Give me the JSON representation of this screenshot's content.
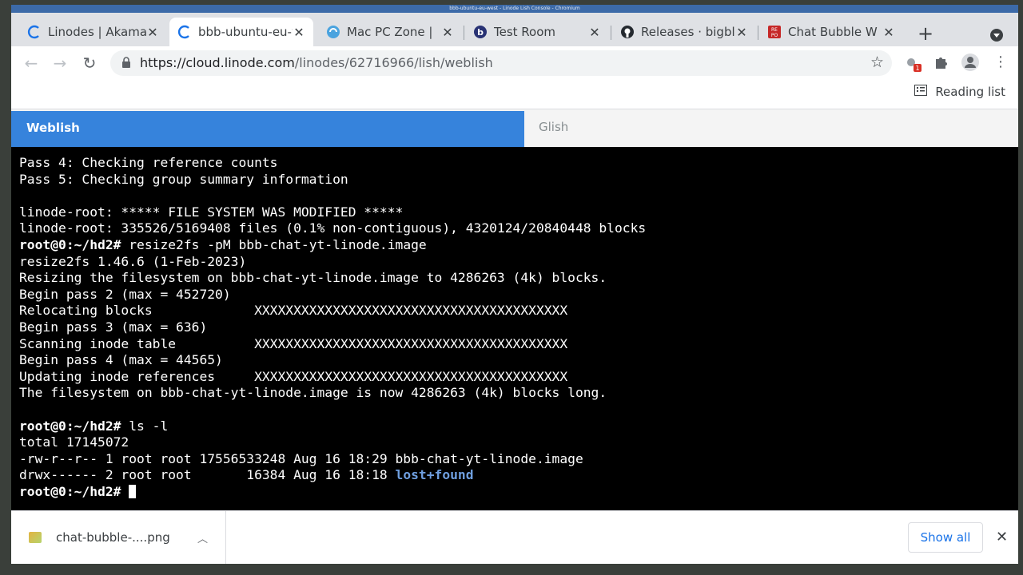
{
  "window": {
    "title": "bbb-ubuntu-eu-west - Linode Lish Console - Chromium"
  },
  "tabs": [
    {
      "title": "Linodes | Akamai",
      "icon": "linode-icon"
    },
    {
      "title": "bbb-ubuntu-eu-west",
      "icon": "linode-icon",
      "active": true
    },
    {
      "title": "Mac PC Zone | ",
      "icon": "macpczone-icon"
    },
    {
      "title": "Test Room",
      "icon": "bigbluebutton-icon"
    },
    {
      "title": "Releases · bigbluebutton",
      "icon": "github-icon"
    },
    {
      "title": "Chat Bubble W",
      "icon": "repo-icon"
    }
  ],
  "toolbar": {
    "url_host": "https://cloud.linode.com",
    "url_path": "/linodes/62716966/lish/weblish",
    "extension_badge": "1",
    "reading_list": "Reading list"
  },
  "lish": {
    "tab_weblish": "Weblish",
    "tab_glish": "Glish"
  },
  "terminal": {
    "lines": [
      {
        "text": "Pass 4: Checking reference counts"
      },
      {
        "text": "Pass 5: Checking group summary information"
      },
      {
        "text": ""
      },
      {
        "text": "linode-root: ***** FILE SYSTEM WAS MODIFIED *****"
      },
      {
        "text": "linode-root: 335526/5169408 files (0.1% non-contiguous), 4320124/20840448 blocks"
      },
      {
        "prompt": "root@0:~/hd2#",
        "text": " resize2fs -pM bbb-chat-yt-linode.image"
      },
      {
        "text": "resize2fs 1.46.6 (1-Feb-2023)"
      },
      {
        "text": "Resizing the filesystem on bbb-chat-yt-linode.image to 4286263 (4k) blocks."
      },
      {
        "text": "Begin pass 2 (max = 452720)"
      },
      {
        "text": "Relocating blocks             XXXXXXXXXXXXXXXXXXXXXXXXXXXXXXXXXXXXXXXX"
      },
      {
        "text": "Begin pass 3 (max = 636)"
      },
      {
        "text": "Scanning inode table          XXXXXXXXXXXXXXXXXXXXXXXXXXXXXXXXXXXXXXXX"
      },
      {
        "text": "Begin pass 4 (max = 44565)"
      },
      {
        "text": "Updating inode references     XXXXXXXXXXXXXXXXXXXXXXXXXXXXXXXXXXXXXXXX"
      },
      {
        "text": "The filesystem on bbb-chat-yt-linode.image is now 4286263 (4k) blocks long."
      },
      {
        "text": ""
      },
      {
        "prompt": "root@0:~/hd2#",
        "text": " ls -l"
      },
      {
        "text": "total 17145072"
      },
      {
        "text": "-rw-r--r-- 1 root root 17556533248 Aug 16 18:29 bbb-chat-yt-linode.image"
      },
      {
        "text": "drwx------ 2 root root       16384 Aug 16 18:18 ",
        "dir": "lost+found"
      },
      {
        "prompt": "root@0:~/hd2#",
        "text": " ",
        "cursor": true
      }
    ]
  },
  "downloads": {
    "file_name": "chat-bubble-....png",
    "show_all": "Show all"
  },
  "colors": {
    "weblish_tab": "#3683dc",
    "terminal_bg": "#000000",
    "dir_color": "#6f9fe0"
  }
}
